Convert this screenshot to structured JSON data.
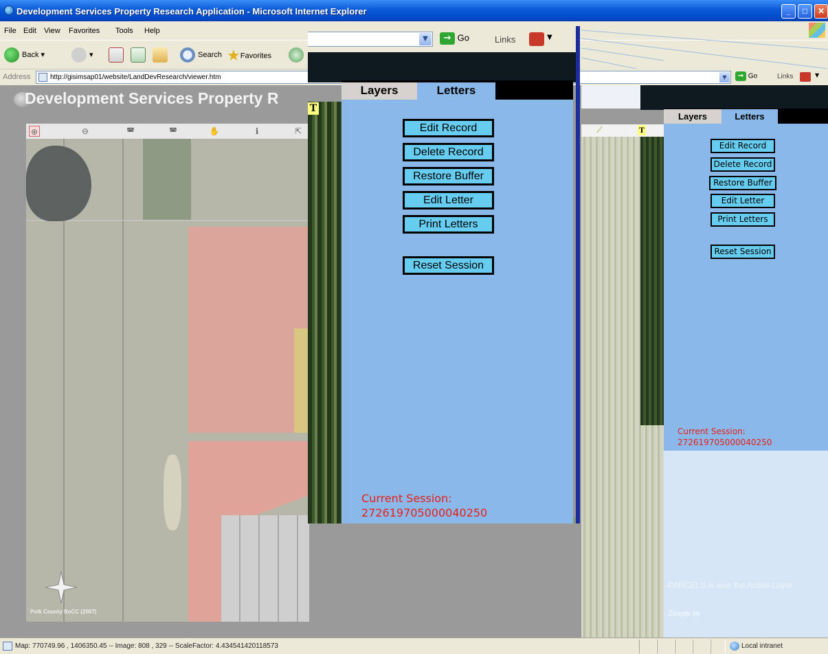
{
  "window": {
    "title": "Development Services Property Research Application - Microsoft Internet Explorer"
  },
  "menu": {
    "items": [
      "File",
      "Edit",
      "View",
      "Favorites",
      "Tools",
      "Help"
    ]
  },
  "toolbar": {
    "back_label": "Back",
    "search_label": "Search",
    "favorites_label": "Favorites"
  },
  "address": {
    "label": "Address",
    "url": "http://gisimsap01/website/LandDevResearch/viewer.htm"
  },
  "mid_toolbar": {
    "go_label": "Go",
    "links_label": "Links"
  },
  "right_toolbar": {
    "go_label": "Go",
    "links_label": "Links"
  },
  "page": {
    "title": "Development Services Property R",
    "map_credit": "Polk County BoCC (2007)"
  },
  "map_tools": [
    "zoom-in",
    "zoom-out",
    "zoom-previous",
    "zoom-full",
    "pan",
    "identify",
    "measure"
  ],
  "panel": {
    "tabs": [
      "Layers",
      "Letters"
    ],
    "active_tab": "Letters",
    "buttons": {
      "edit_record": "Edit Record",
      "delete_record": "Delete Record",
      "restore_buffer": "Restore Buffer",
      "edit_letter": "Edit Letter",
      "print_letters": "Print Letters",
      "reset_session": "Reset Session"
    },
    "session_label": "Current Session:",
    "session_id": "272619705000040250",
    "map_label_T": "T"
  },
  "right_panel": {
    "active_layer_message": "PARCELS is now the Active Layer",
    "active_tool": "Zoom In"
  },
  "status": {
    "text": "Map: 770749.96 , 1406350.45 -- Image: 808 , 329 -- ScaleFactor: 4.434541420118573",
    "zone": "Local intranet"
  },
  "colors": {
    "panel_bg": "#8ab8e8",
    "button_bg": "#66ccf0",
    "session_text": "#e8201c",
    "xp_title": "#0a5ad8"
  }
}
